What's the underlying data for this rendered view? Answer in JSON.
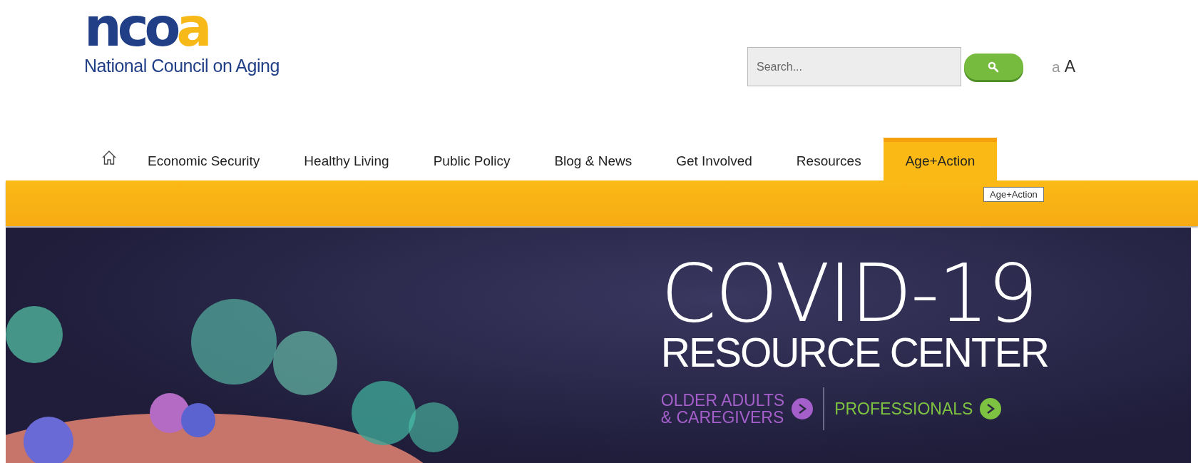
{
  "logo": {
    "wordmark": [
      {
        "text": "nco",
        "color": "#213f86"
      },
      {
        "text": "a",
        "color": "#f7b918"
      }
    ],
    "tagline": "National Council on Aging"
  },
  "search": {
    "placeholder": "Search..."
  },
  "text_size": {
    "small": "a",
    "large": "A"
  },
  "nav": {
    "items": [
      {
        "label": "Economic Security",
        "selected": false
      },
      {
        "label": "Healthy Living",
        "selected": false
      },
      {
        "label": "Public Policy",
        "selected": false
      },
      {
        "label": "Blog & News",
        "selected": false
      },
      {
        "label": "Get Involved",
        "selected": false
      },
      {
        "label": "Resources",
        "selected": false
      },
      {
        "label": "Age+Action",
        "selected": true
      }
    ],
    "tooltip": "Age+Action"
  },
  "hero": {
    "title": "COVID-19",
    "subtitle": "RESOURCE CENTER",
    "links": [
      {
        "lines": [
          "OLDER ADULTS",
          "& CAREGIVERS"
        ],
        "color": "#a45fcb"
      },
      {
        "lines": [
          "PROFESSIONALS"
        ],
        "color": "#7ec242"
      }
    ]
  }
}
